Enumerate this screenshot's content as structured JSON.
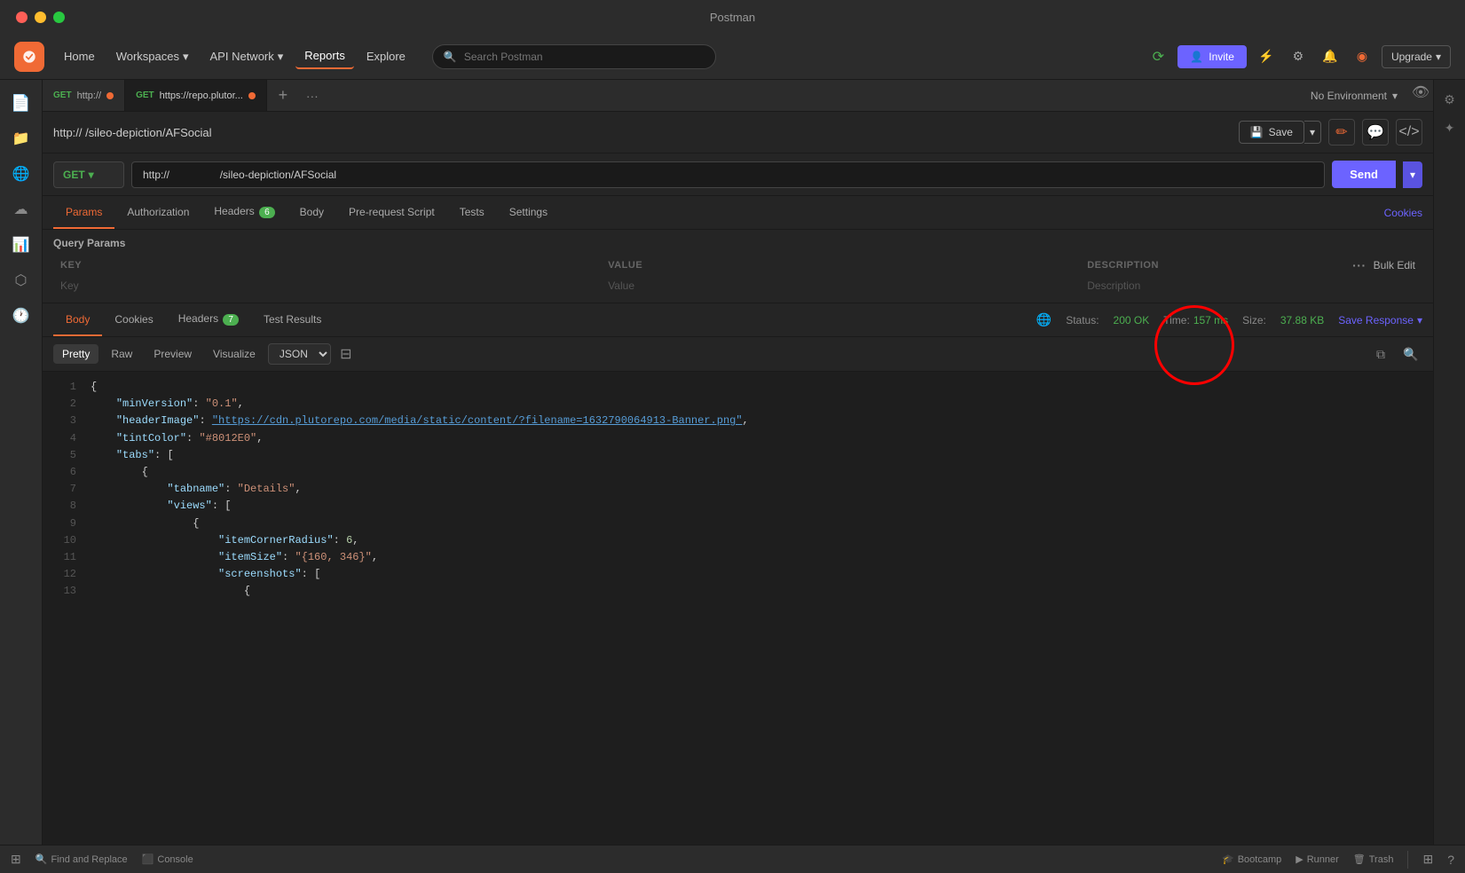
{
  "titleBar": {
    "title": "Postman"
  },
  "nav": {
    "home": "Home",
    "workspaces": "Workspaces",
    "apiNetwork": "API Network",
    "reports": "Reports",
    "explore": "Explore",
    "searchPlaceholder": "Search Postman",
    "invite": "Invite",
    "upgrade": "Upgrade"
  },
  "tabs": [
    {
      "method": "GET",
      "url": "http://",
      "dot": true,
      "active": false
    },
    {
      "method": "GET",
      "url": "https://repo.plutor...",
      "dot": true,
      "active": true
    }
  ],
  "request": {
    "breadcrumb": "http://                 /sileo-depiction/AFSocial",
    "method": "GET",
    "url": "http://                 /sileo-depiction/AFSocial",
    "save": "Save"
  },
  "requestTabs": {
    "params": "Params",
    "authorization": "Authorization",
    "headers": "Headers",
    "headersCount": "6",
    "body": "Body",
    "preRequestScript": "Pre-request Script",
    "tests": "Tests",
    "settings": "Settings",
    "cookies": "Cookies"
  },
  "queryParams": {
    "label": "Query Params",
    "keyHeader": "KEY",
    "valueHeader": "VALUE",
    "descriptionHeader": "DESCRIPTION",
    "bulkEdit": "Bulk Edit",
    "keyPlaceholder": "Key",
    "valuePlaceholder": "Value",
    "descriptionPlaceholder": "Description"
  },
  "responseTabs": {
    "body": "Body",
    "cookies": "Cookies",
    "headers": "Headers",
    "headersCount": "7",
    "testResults": "Test Results",
    "status": "Status:",
    "statusValue": "200 OK",
    "time": "Time:",
    "timeValue": "157 ms",
    "size": "Size:",
    "sizeValue": "37.88 KB",
    "saveResponse": "Save Response"
  },
  "formatBar": {
    "pretty": "Pretty",
    "raw": "Raw",
    "preview": "Preview",
    "visualize": "Visualize",
    "format": "JSON"
  },
  "jsonBody": [
    {
      "num": 1,
      "content": "{"
    },
    {
      "num": 2,
      "content": "  \"minVersion\": \"0.1\","
    },
    {
      "num": 3,
      "content": "  \"headerImage\": \"https://cdn.plutorepo.com/media/static/content/?filename=1632790064913-Banner.png\","
    },
    {
      "num": 4,
      "content": "  \"tintColor\": \"#8012E0\","
    },
    {
      "num": 5,
      "content": "  \"tabs\": ["
    },
    {
      "num": 6,
      "content": "    {"
    },
    {
      "num": 7,
      "content": "      \"tabname\": \"Details\","
    },
    {
      "num": 8,
      "content": "      \"views\": ["
    },
    {
      "num": 9,
      "content": "        {"
    },
    {
      "num": 10,
      "content": "          \"itemCornerRadius\": 6,"
    },
    {
      "num": 11,
      "content": "          \"itemSize\": \"{160, 346}\","
    },
    {
      "num": 12,
      "content": "          \"screenshots\": ["
    },
    {
      "num": 13,
      "content": "            {"
    }
  ],
  "statusBar": {
    "findAndReplace": "Find and Replace",
    "console": "Console",
    "bootcamp": "Bootcamp",
    "runner": "Runner",
    "trash": "Trash"
  },
  "env": {
    "noEnvironment": "No Environment"
  }
}
